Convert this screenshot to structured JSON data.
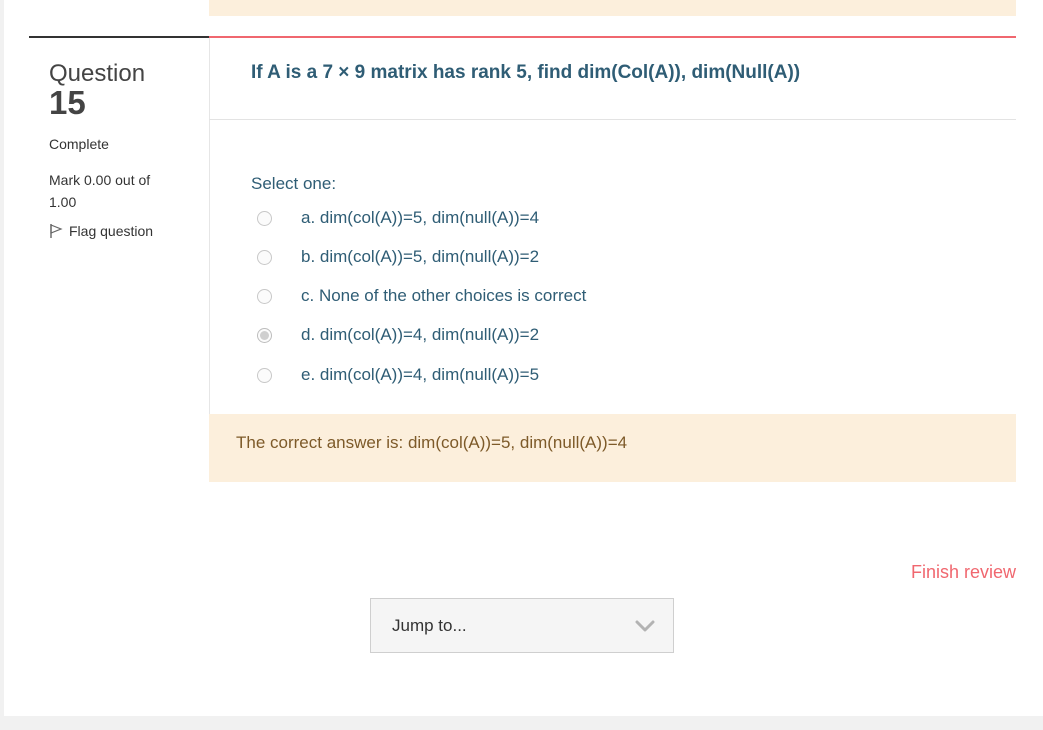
{
  "question_info": {
    "label": "Question",
    "number": "15",
    "state": "Complete",
    "mark": "Mark 0.00 out of 1.00",
    "flag_label": "Flag question"
  },
  "question": {
    "text": "If A is a 7 × 9 matrix has rank 5, find dim(Col(A)), dim(Null(A))",
    "prompt": "Select one:",
    "options": [
      {
        "label": "a. dim(col(A))=5, dim(null(A))=4",
        "selected": false
      },
      {
        "label": "b. dim(col(A))=5, dim(null(A))=2",
        "selected": false
      },
      {
        "label": "c. None of the other choices is correct",
        "selected": false
      },
      {
        "label": "d. dim(col(A))=4, dim(null(A))=2",
        "selected": true
      },
      {
        "label": "e. dim(col(A))=4, dim(null(A))=5",
        "selected": false
      }
    ]
  },
  "feedback": {
    "correct_answer": "The correct answer is: dim(col(A))=5, dim(null(A))=4"
  },
  "navigation": {
    "finish_review": "Finish review",
    "jump_placeholder": "Jump to..."
  },
  "colors": {
    "accent": "#f0676f",
    "question_text": "#2f5d75",
    "feedback_bg": "#fcefdc",
    "feedback_text": "#7d5a29"
  }
}
